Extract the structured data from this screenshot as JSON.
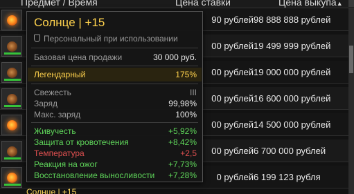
{
  "header": {
    "item_col": "Предмет",
    "separator": "/",
    "time_col": "Время",
    "bid_col": "Цена ставки",
    "buy_col": "Цена выкупа",
    "sort_indicator": "▲"
  },
  "rows": [
    {
      "icon": "sun-artifact-icon",
      "bid": "90 рублей",
      "buy": "98 888 888 рублей"
    },
    {
      "icon": "artifact-icon",
      "bid": "00 рублей",
      "buy": "19 499 999 рублей"
    },
    {
      "icon": "artifact-icon",
      "bid": "00 рублей",
      "buy": "19 000 000 рублей"
    },
    {
      "icon": "artifact-icon",
      "bid": "00 рублей",
      "buy": "16 600 000 рублей"
    },
    {
      "icon": "sun-artifact-icon",
      "bid": "00 рублей",
      "buy": "14 500 000 рублей"
    },
    {
      "icon": "artifact-icon",
      "bid": "00 рублей",
      "buy": "6 700 000 рублей"
    },
    {
      "icon": "sun-artifact-icon",
      "bid": "0 рублей",
      "buy": "6 199 123 рубля"
    }
  ],
  "next_row_label": "Солнце | +15",
  "tooltip": {
    "title": "Солнце | +15",
    "personal": "Персональный при использовании",
    "base_price_label": "Базовая цена продажи",
    "base_price_value": "30 000 руб.",
    "rarity_label": "Легендарный",
    "rarity_value": "175%",
    "freshness_label": "Свежесть",
    "freshness_value": "III",
    "charge_label": "Заряд",
    "charge_value": "99,98%",
    "max_charge_label": "Макс. заряд",
    "max_charge_value": "100%",
    "stats": [
      {
        "label": "Живучесть",
        "value": "+5,92%",
        "color": "#5fd65a"
      },
      {
        "label": "Защита от кровотечения",
        "value": "+8,42%",
        "color": "#5fd65a"
      },
      {
        "label": "Температура",
        "value": "+2,5",
        "color": "#e05050"
      },
      {
        "label": "Реакция на ожог",
        "value": "+7,73%",
        "color": "#5fd65a"
      },
      {
        "label": "Восстановление выносливости",
        "value": "+7,28%",
        "color": "#5fd65a"
      }
    ]
  },
  "colors": {
    "legendary": "#ffd24d",
    "positive": "#5fd65a",
    "negative": "#e05050",
    "background": "#121212"
  }
}
